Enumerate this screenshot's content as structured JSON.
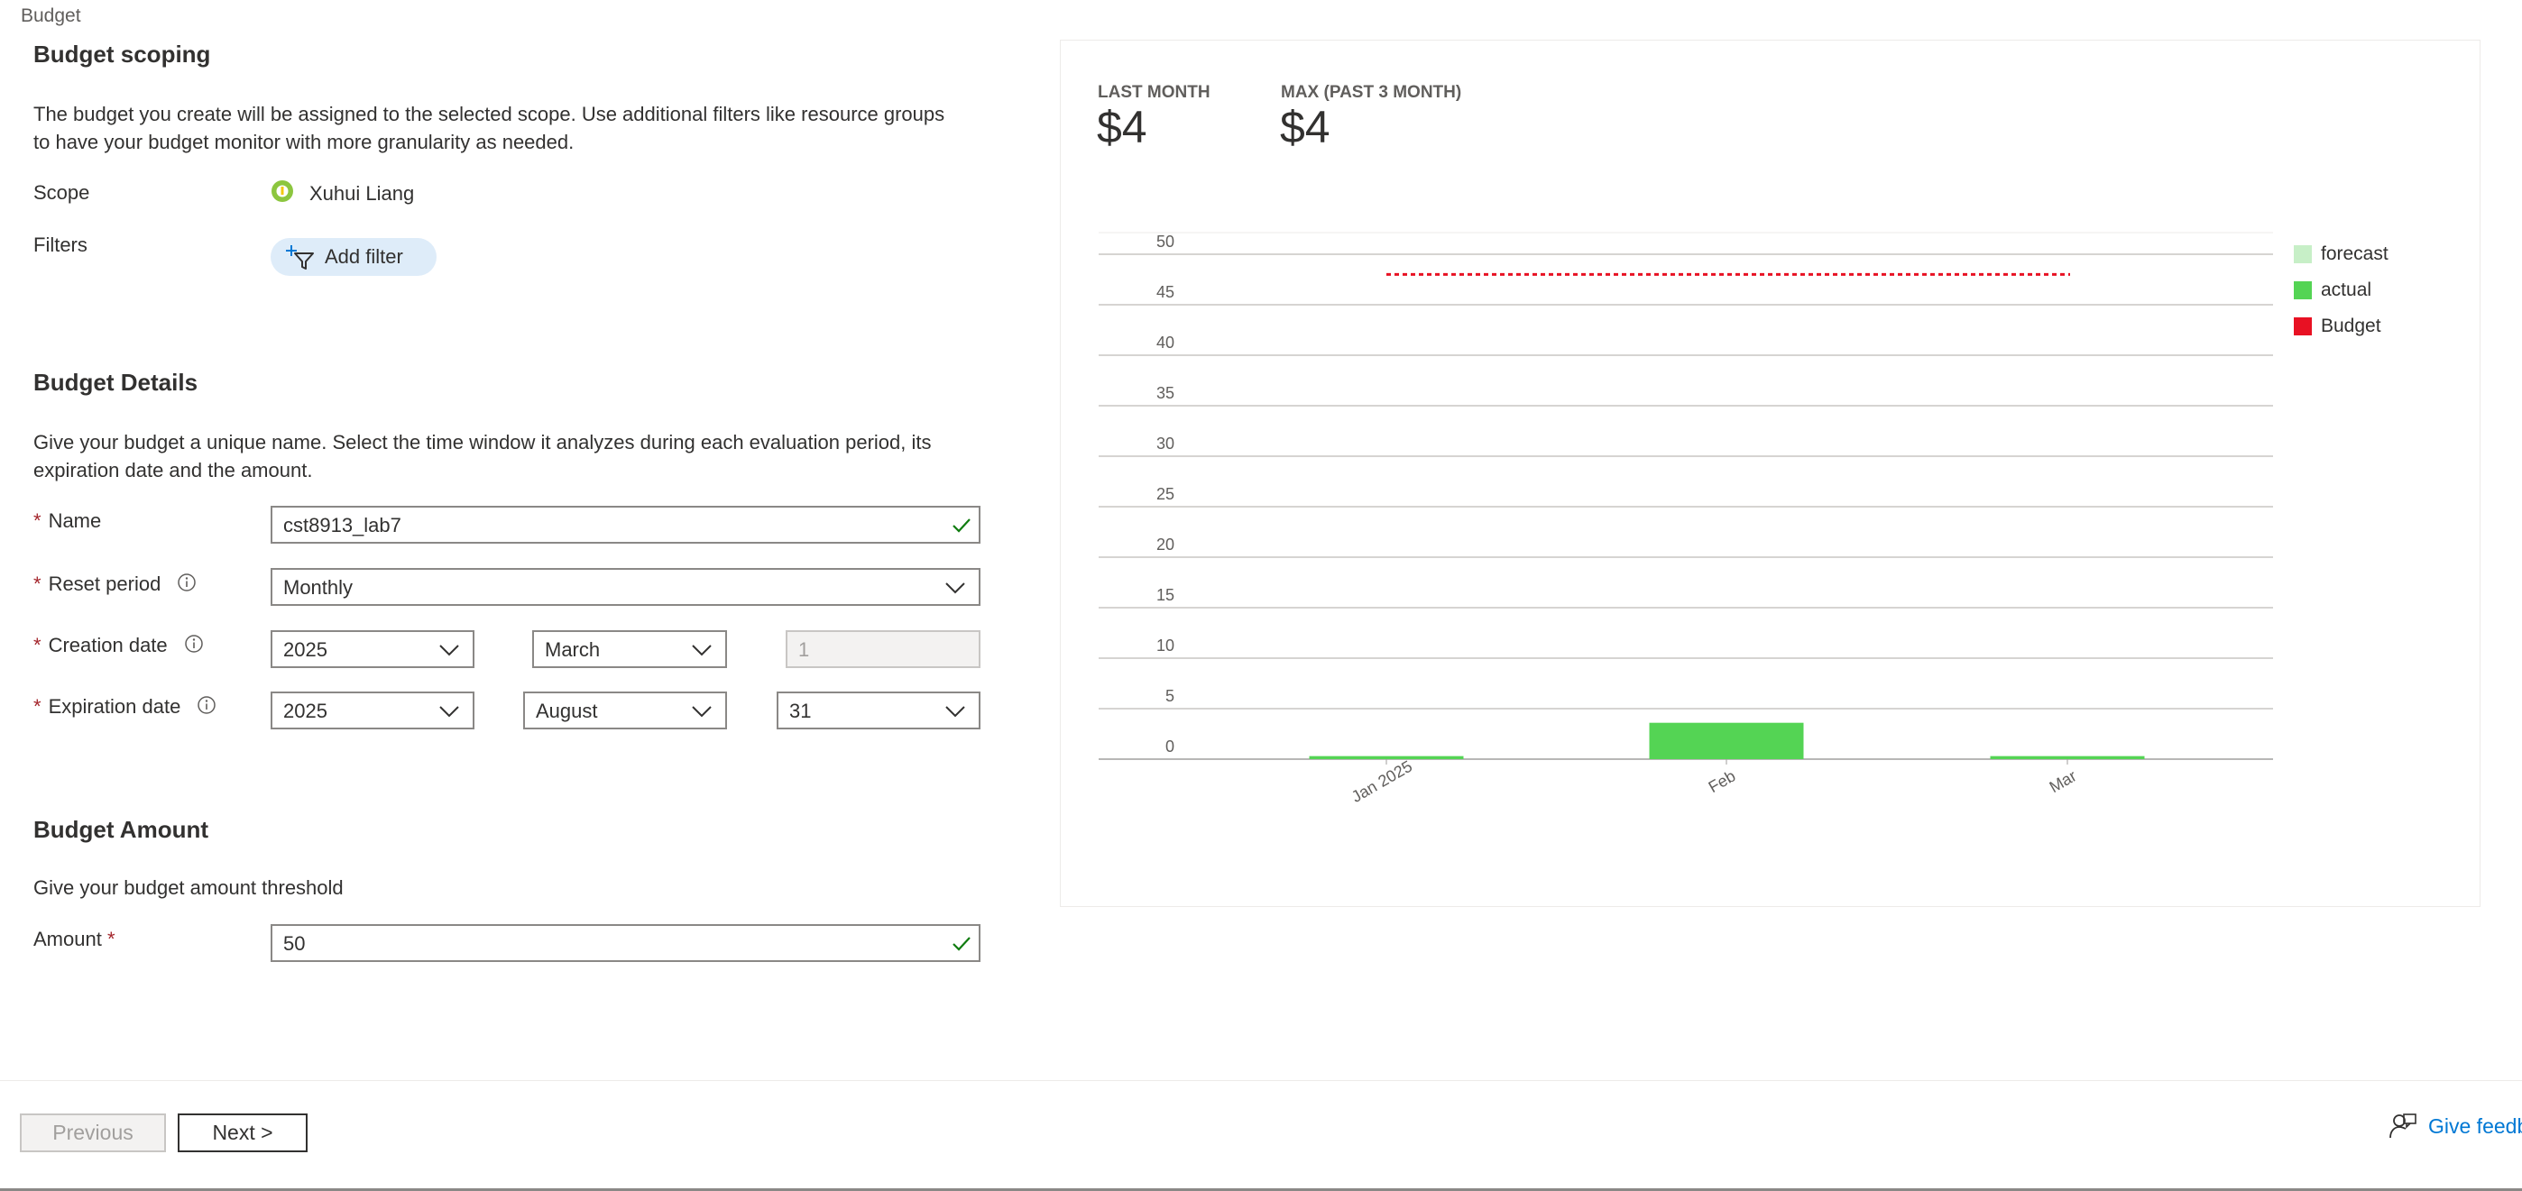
{
  "breadcrumb": "Budget",
  "scoping": {
    "title": "Budget scoping",
    "description_line1": "The budget you create will be assigned to the selected scope. Use additional filters like resource groups",
    "description_line2": "to have your budget monitor with more granularity as needed.",
    "scope_label": "Scope",
    "scope_value": "Xuhui Liang",
    "filters_label": "Filters",
    "add_filter_label": "Add filter"
  },
  "details": {
    "title": "Budget Details",
    "description_line1": "Give your budget a unique name. Select the time window it analyzes during each evaluation period, its",
    "description_line2": "expiration date and the amount.",
    "required_mark": "*",
    "name_label": "Name",
    "name_value": "cst8913_lab7",
    "reset_label": "Reset period",
    "reset_value": "Monthly",
    "creation_label": "Creation date",
    "creation_year": "2025",
    "creation_month": "March",
    "creation_day": "1",
    "expiration_label": "Expiration date",
    "expiration_year": "2025",
    "expiration_month": "August",
    "expiration_day": "31"
  },
  "amount": {
    "title": "Budget Amount",
    "description": "Give your budget amount threshold",
    "amount_label": "Amount",
    "required_mark": "*",
    "amount_value": "50"
  },
  "stats": {
    "last_month_label": "LAST MONTH",
    "last_month_value": "$4",
    "max_label": "MAX (PAST 3 MONTH)",
    "max_value": "$4"
  },
  "chart_data": {
    "type": "bar",
    "categories": [
      "Jan 2025",
      "Feb",
      "Mar"
    ],
    "series": [
      {
        "name": "forecast",
        "values": [
          0,
          0,
          0
        ],
        "color": "#c7efc7"
      },
      {
        "name": "actual",
        "values": [
          0.3,
          3.6,
          0.3
        ],
        "color": "#54d454"
      }
    ],
    "budget": {
      "name": "Budget",
      "value": 48,
      "color": "#e81123"
    },
    "y_ticks": [
      0,
      5,
      10,
      15,
      20,
      25,
      30,
      35,
      40,
      45,
      50
    ],
    "ylim": [
      0,
      50
    ],
    "legend": "right",
    "grid": true
  },
  "footer": {
    "previous_label": "Previous",
    "next_label": "Next >",
    "feedback_label": "Give feedback"
  }
}
